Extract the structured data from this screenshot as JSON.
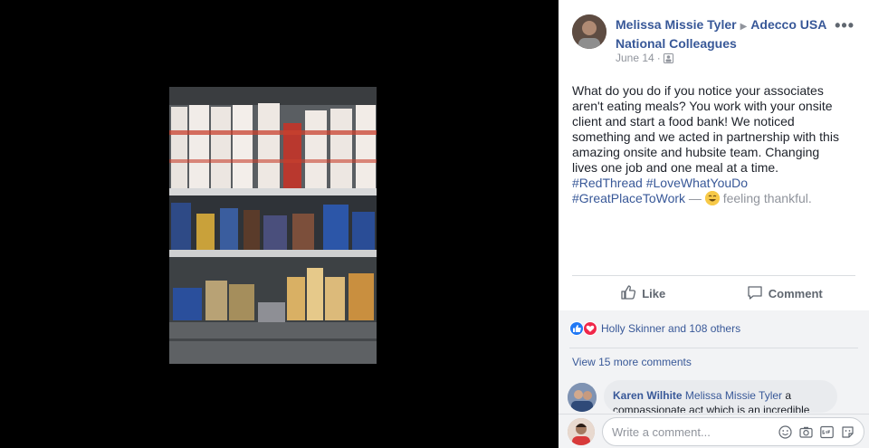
{
  "photo": {
    "alt": "Shelves stocked with instant noodle cups, canned goods, snack packs and fruit cups"
  },
  "post": {
    "author": "Melissa Missie Tyler",
    "group": "Adecco USA National Colleagues",
    "date": "June 14",
    "date_separator": "·",
    "more_label": "•••",
    "text": "What do you do if you notice your associates aren't eating meals? You work with your onsite client and start a food bank! We noticed something and we acted in partnership with this amazing onsite and hubsite team. Changing lives one job and one meal at a time.",
    "hashtags": [
      "#RedThread",
      "#LoveWhatYouDo",
      "#GreatPlaceToWork"
    ],
    "feeling_dash": "—",
    "feeling": "feeling thankful."
  },
  "actions": {
    "like_label": "Like",
    "comment_label": "Comment"
  },
  "reactions": {
    "summary": "Holly Skinner and 108 others"
  },
  "comments": {
    "view_more": "View 15 more comments",
    "items": [
      {
        "author": "Karen Wilhite",
        "mention": "Melissa Missie Tyler",
        "text": "a compassionate act which is an incredible"
      }
    ]
  },
  "composer": {
    "placeholder": "Write a comment..."
  },
  "colors": {
    "link": "#385898",
    "like_blue": "#2078f4",
    "love_red": "#f0284a"
  }
}
